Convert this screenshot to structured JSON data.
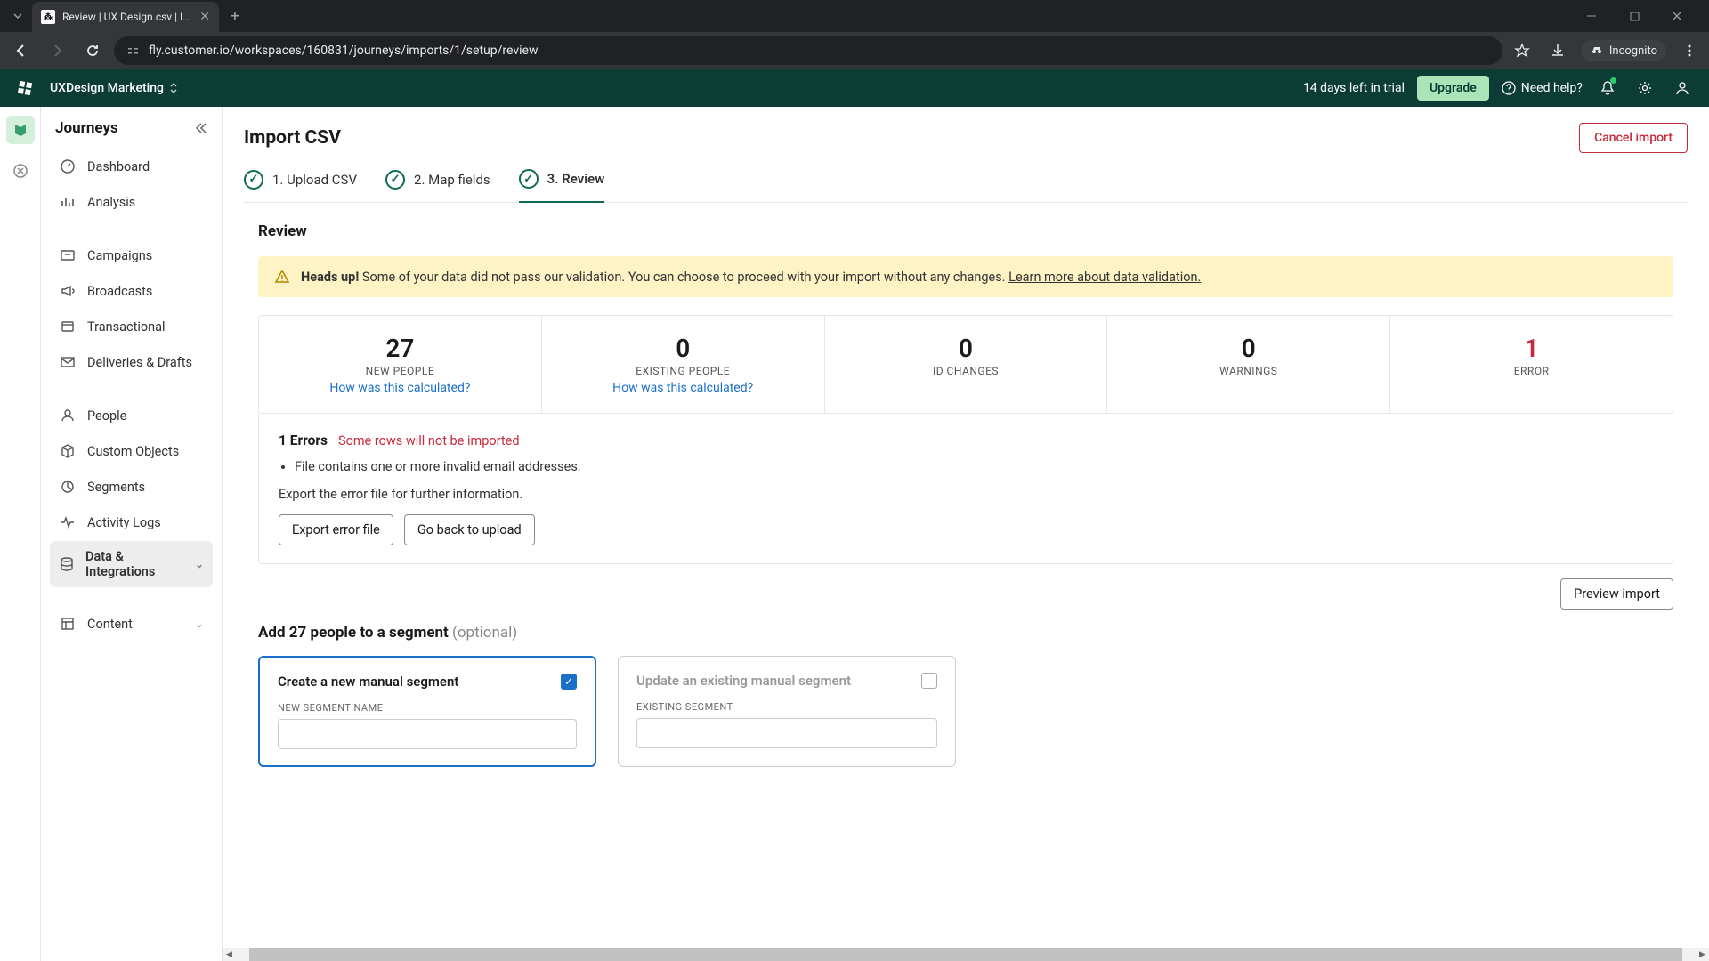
{
  "browser": {
    "tab_title": "Review | UX Design.csv | Import",
    "url": "fly.customer.io/workspaces/160831/journeys/imports/1/setup/review",
    "incognito_label": "Incognito"
  },
  "header": {
    "workspace": "UXDesign Marketing",
    "trial": "14 days left in trial",
    "upgrade": "Upgrade",
    "help": "Need help?"
  },
  "sidebar": {
    "title": "Journeys",
    "items": [
      {
        "label": "Dashboard"
      },
      {
        "label": "Analysis"
      },
      {
        "label": "Campaigns"
      },
      {
        "label": "Broadcasts"
      },
      {
        "label": "Transactional"
      },
      {
        "label": "Deliveries & Drafts"
      },
      {
        "label": "People"
      },
      {
        "label": "Custom Objects"
      },
      {
        "label": "Segments"
      },
      {
        "label": "Activity Logs"
      },
      {
        "label": "Data & Integrations"
      },
      {
        "label": "Content"
      }
    ]
  },
  "page": {
    "title": "Import CSV",
    "cancel": "Cancel import",
    "steps": [
      {
        "label": "1. Upload CSV"
      },
      {
        "label": "2. Map fields"
      },
      {
        "label": "3. Review"
      }
    ],
    "section_title": "Review",
    "alert": {
      "heads": "Heads up!",
      "body": "Some of your data did not pass our validation. You can choose to proceed with your import without any changes.",
      "link": "Learn more about data validation."
    },
    "stats": {
      "new_people": {
        "num": "27",
        "label": "NEW PEOPLE",
        "link": "How was this calculated?"
      },
      "existing_people": {
        "num": "0",
        "label": "EXISTING PEOPLE",
        "link": "How was this calculated?"
      },
      "id_changes": {
        "num": "0",
        "label": "ID CHANGES"
      },
      "warnings": {
        "num": "0",
        "label": "WARNINGS"
      },
      "error": {
        "num": "1",
        "label": "ERROR"
      }
    },
    "errors": {
      "title": "1 Errors",
      "sub": "Some rows will not be imported",
      "item": "File contains one or more invalid email addresses.",
      "note": "Export the error file for further information.",
      "export_btn": "Export error file",
      "back_btn": "Go back to upload"
    },
    "preview_btn": "Preview import",
    "segment": {
      "title_prefix": "Add 27 people to a segment ",
      "optional": "(optional)",
      "create": {
        "title": "Create a new manual segment",
        "field_label": "NEW SEGMENT NAME"
      },
      "update": {
        "title": "Update an existing manual segment",
        "field_label": "EXISTING SEGMENT"
      }
    }
  }
}
